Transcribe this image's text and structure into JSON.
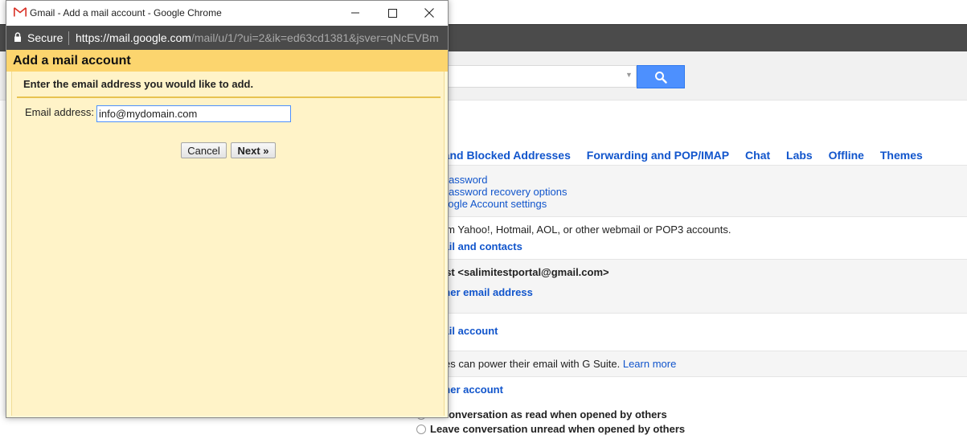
{
  "popup": {
    "window_title": "Gmail - Add a mail account - Google Chrome",
    "secure_label": "Secure",
    "url_host": "https://mail.google.com",
    "url_path": "/mail/u/1/?ui=2&ik=ed63cd1381&jsver=qNcEVBm",
    "dialog_title": "Add a mail account",
    "instruction": "Enter the email address you would like to add.",
    "email_label": "Email address:",
    "email_value": "info@mydomain.com",
    "cancel_label": "Cancel",
    "next_label": "Next »"
  },
  "background": {
    "tabs": [
      "s and Blocked Addresses",
      "Forwarding and POP/IMAP",
      "Chat",
      "Labs",
      "Offline",
      "Themes"
    ],
    "account_links": [
      "e password",
      "e password recovery options",
      "Google Account settings"
    ],
    "import_text": "from Yahoo!, Hotmail, AOL, or other webmail or POP3 accounts.",
    "import_link": "mail and contacts",
    "send_as_text": "Test <salimitestportal@gmail.com>",
    "send_as_link": "other email address",
    "check_mail_link": "mail account",
    "gsuite_text": "sses can power their email with G Suite.",
    "gsuite_link": "Learn more",
    "grant_link": "other account",
    "radio_1": "k conversation as read when opened by others",
    "radio_2": "Leave conversation unread when opened by others"
  },
  "colors": {
    "accent_blue": "#1155cc",
    "search_button": "#4d90fe",
    "dialog_header": "#fcd56e",
    "dialog_body": "#fff3c8"
  }
}
